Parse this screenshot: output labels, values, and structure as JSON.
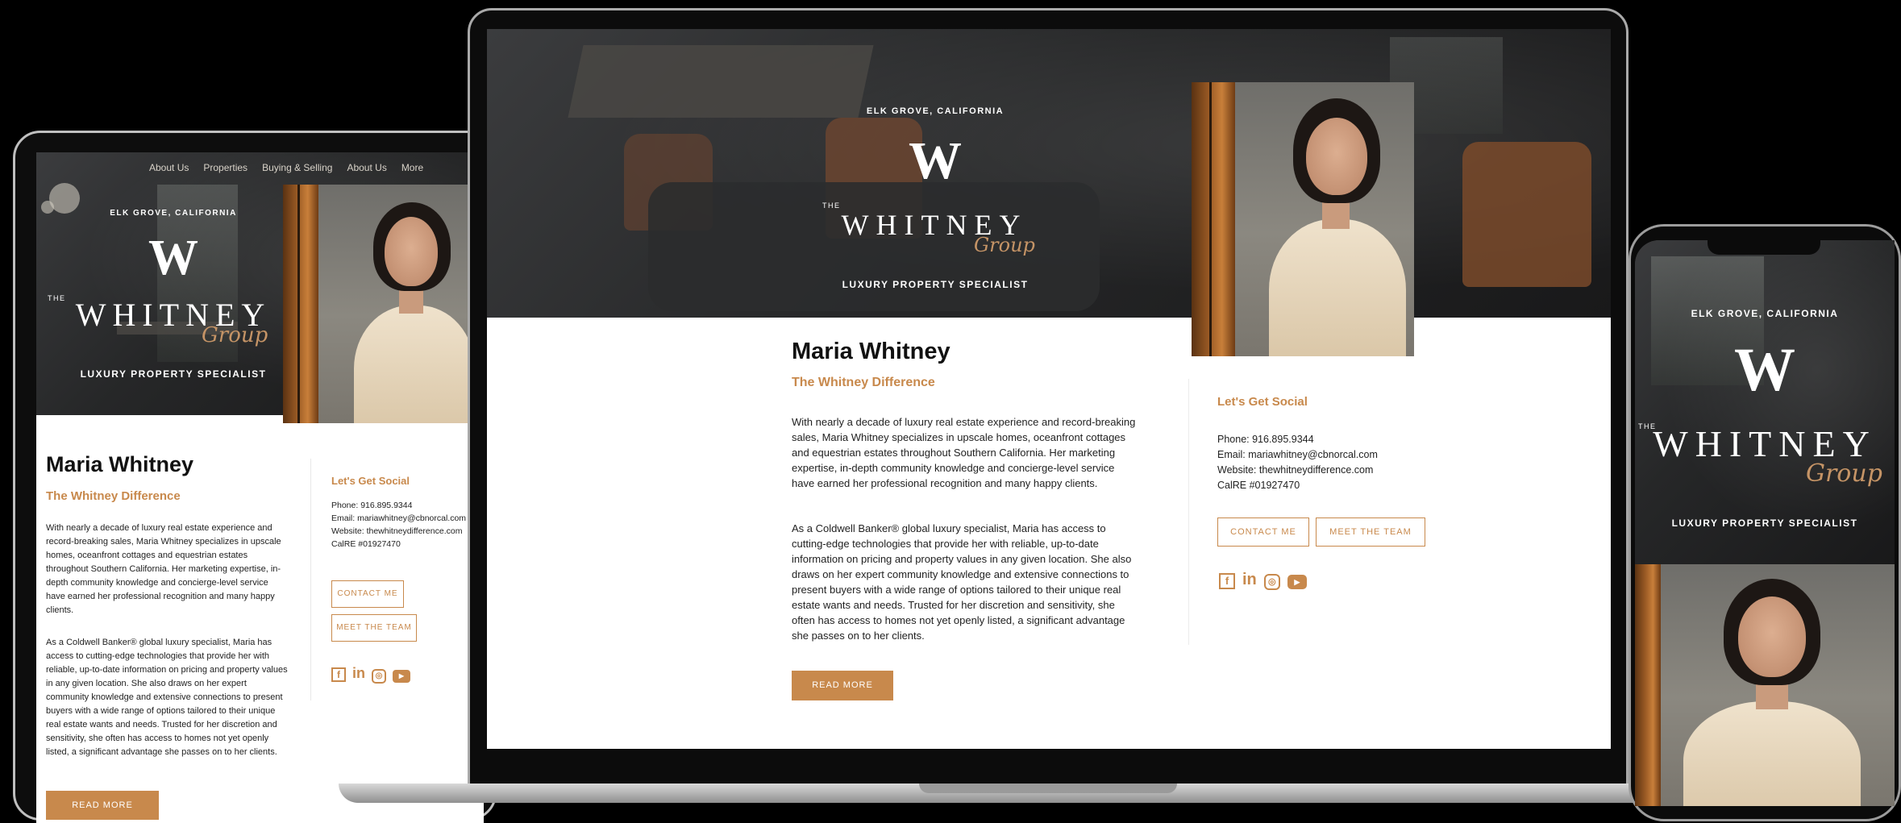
{
  "location": "ELK GROVE, CALIFORNIA",
  "logo": {
    "small": "THE",
    "name": "WHITNEY",
    "script": "Group"
  },
  "tagline": "LUXURY PROPERTY SPECIALIST",
  "agent_name": "Maria Whitney",
  "subtitle": "The Whitney Difference",
  "paragraph1": "With nearly a decade of luxury real estate experience and record-breaking sales, Maria Whitney specializes in upscale homes, oceanfront cottages and equestrian estates throughout Southern California. Her marketing expertise, in-depth community knowledge and concierge-level service have earned her professional recognition and many happy clients.",
  "paragraph2": "As a Coldwell Banker® global luxury specialist, Maria has access to cutting-edge technologies that provide her with reliable, up-to-date information on pricing and property values in any given location. She also draws on her expert community knowledge and extensive connections to present buyers with a wide range of options tailored to their unique real estate wants and needs. Trusted for her discretion and sensitivity, she often has access to homes not yet openly listed, a significant advantage she passes on to her clients.",
  "social": {
    "heading": "Let's Get Social",
    "phone": "Phone: 916.895.9344",
    "email": "Email: mariawhitney@cbnorcal.com",
    "website": "Website: thewhitneydifference.com",
    "license": "CalRE #01927470"
  },
  "buttons": {
    "contact": "CONTACT ME",
    "team": "MEET THE TEAM",
    "read_more": "READ MORE"
  },
  "social_icons": [
    "facebook-icon",
    "linkedin-icon",
    "instagram-icon",
    "youtube-icon"
  ],
  "tablet_nav": [
    "About Us",
    "Properties",
    "Buying & Selling",
    "About Us",
    "More"
  ],
  "colors": {
    "accent": "#c8894c",
    "background": "#000000"
  }
}
